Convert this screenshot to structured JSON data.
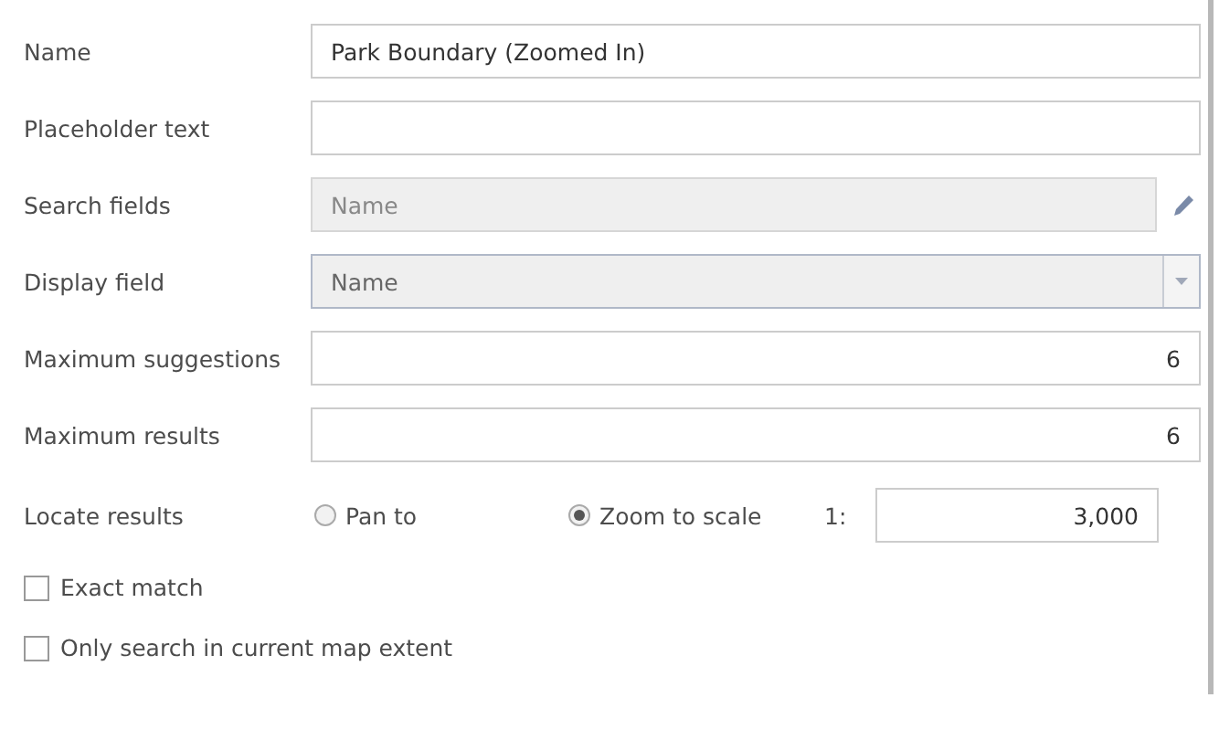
{
  "fields": [
    {
      "label": "Name",
      "kind": "text",
      "value": "Park Boundary (Zoomed In)"
    },
    {
      "label": "Placeholder text",
      "kind": "text"
    },
    {
      "label": "Search fields",
      "kind": "picker",
      "value": "Name"
    },
    {
      "label": "Display field",
      "kind": "dropdown",
      "value": "Name"
    },
    {
      "label": "Maximum suggestions",
      "kind": "number",
      "value": "6"
    },
    {
      "label": "Maximum results",
      "kind": "number",
      "value": "6"
    }
  ],
  "locate": {
    "label": "Locate results",
    "options": [
      {
        "label": "Pan to",
        "selected": false
      },
      {
        "label": "Zoom to scale",
        "selected": true
      }
    ],
    "scale_prefix": "1:",
    "scale": "3,000"
  },
  "checkboxes": [
    {
      "label": "Exact match",
      "checked": false
    },
    {
      "label": "Only search in current map extent",
      "checked": false
    }
  ]
}
